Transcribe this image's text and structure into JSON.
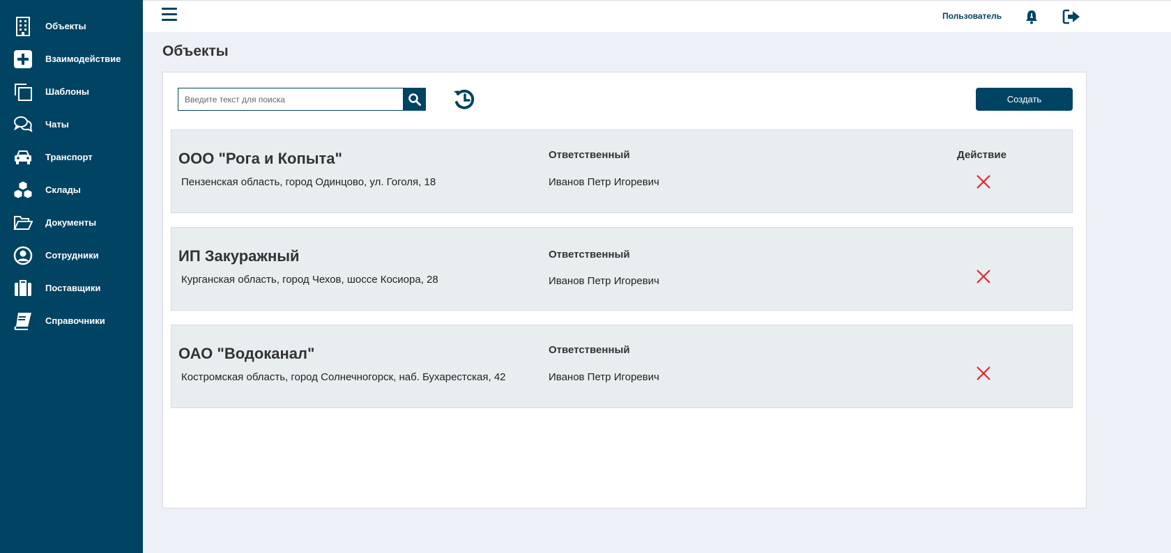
{
  "sidebar": {
    "items": [
      {
        "label": "Объекты",
        "icon": "building-icon"
      },
      {
        "label": "Взаимодействие",
        "icon": "plus-square-icon"
      },
      {
        "label": "Шаблоны",
        "icon": "copy-icon"
      },
      {
        "label": "Чаты",
        "icon": "chat-bubbles-icon"
      },
      {
        "label": "Транспорт",
        "icon": "car-icon"
      },
      {
        "label": "Склады",
        "icon": "boxes-icon"
      },
      {
        "label": "Документы",
        "icon": "folder-open-icon"
      },
      {
        "label": "Сотрудники",
        "icon": "user-circle-icon"
      },
      {
        "label": "Поставщики",
        "icon": "suitcase-icon"
      },
      {
        "label": "Справочники",
        "icon": "book-icon"
      }
    ]
  },
  "topbar": {
    "user_label": "Пользователь"
  },
  "page": {
    "title": "Объекты"
  },
  "toolbar": {
    "search_placeholder": "Введите текст для поиска",
    "search_value": "",
    "create_label": "Создать"
  },
  "rows": [
    {
      "name": "ООО \"Рога и Копыта\"",
      "address": "Пензенская область, город Одинцово, ул. Гоголя, 18",
      "responsible_header": "Ответственный",
      "responsible": "Иванов Петр Игоревич",
      "action_header": "Действие"
    },
    {
      "name": "ИП Закуражный",
      "address": "Курганская область, город Чехов, шоссе Косиора, 28",
      "responsible_header": "Ответственный",
      "responsible": "Иванов Петр Игоревич",
      "action_header": ""
    },
    {
      "name": "ОАО \"Водоканал\"",
      "address": "Костромская область, город Солнечногорск, наб. Бухарестская, 42",
      "responsible_header": "Ответственный",
      "responsible": "Иванов Петр Игоревич",
      "action_header": ""
    }
  ],
  "colors": {
    "sidebar_bg": "#004363",
    "accent": "#004363",
    "delete": "#e3262e",
    "row_bg": "#e8eef0",
    "page_bg": "#eef0f7"
  }
}
